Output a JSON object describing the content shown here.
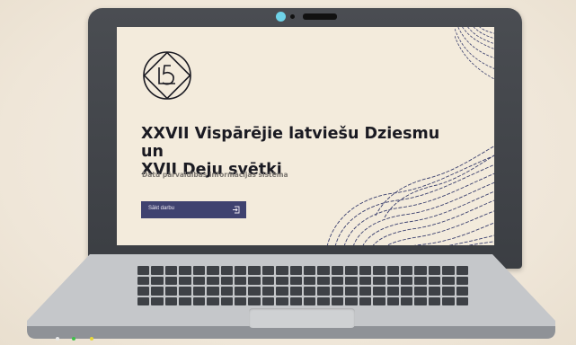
{
  "screen": {
    "title_line1": "XXVII Vispārējie latviešu Dziesmu un",
    "title_line2": "XVII Deju svētki",
    "subtitle": "Datu pārvaldības informācijas sistēma",
    "start_button_label": "Sākt darbu"
  },
  "icons": {
    "logo": "festival-emblem-icon",
    "start": "sign-in-icon",
    "camera": "webcam-icon"
  },
  "colors": {
    "screen_background": "#f3ebdc",
    "button_background": "#3f4270",
    "wave_lines": "#3a3f6e",
    "laptop_body": "#3b3e43",
    "camera_lens": "#6fd3e8"
  }
}
